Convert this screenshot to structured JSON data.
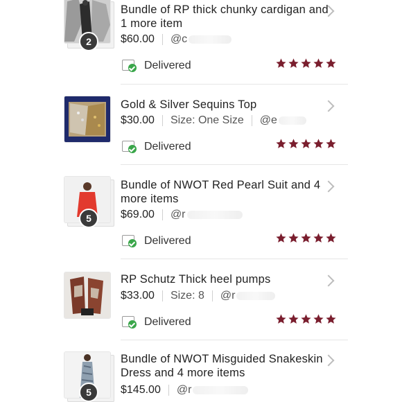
{
  "orders": [
    {
      "title": "Bundle of RP thick chunky cardigan and 1 more item",
      "price": "$60.00",
      "size": "",
      "seller": "@c",
      "count": "2",
      "status": "Delivered",
      "rating": 5,
      "thumb_icon": "cardigan-photo"
    },
    {
      "title": "Gold & Silver Sequins Top",
      "price": "$30.00",
      "size": "Size: One Size",
      "seller": "@e",
      "count": "",
      "status": "Delivered",
      "rating": 5,
      "thumb_icon": "sequins-top-photo"
    },
    {
      "title": "Bundle of NWOT Red Pearl Suit and 4 more items",
      "price": "$69.00",
      "size": "",
      "seller": "@r",
      "count": "5",
      "status": "Delivered",
      "rating": 5,
      "thumb_icon": "red-suit-photo"
    },
    {
      "title": "RP Schutz Thick heel pumps",
      "price": "$33.00",
      "size": "Size: 8",
      "seller": "@r",
      "count": "",
      "status": "Delivered",
      "rating": 5,
      "thumb_icon": "pumps-photo"
    },
    {
      "title": "Bundle of NWOT Misguided Snakeskin Dress and 4 more items",
      "price": "$145.00",
      "size": "",
      "seller": "@r",
      "count": "5",
      "status": "",
      "rating": null,
      "thumb_icon": "snakeskin-dress-photo"
    }
  ],
  "colors": {
    "star": "#7a1e2e",
    "delivered_check": "#3aa64a"
  }
}
